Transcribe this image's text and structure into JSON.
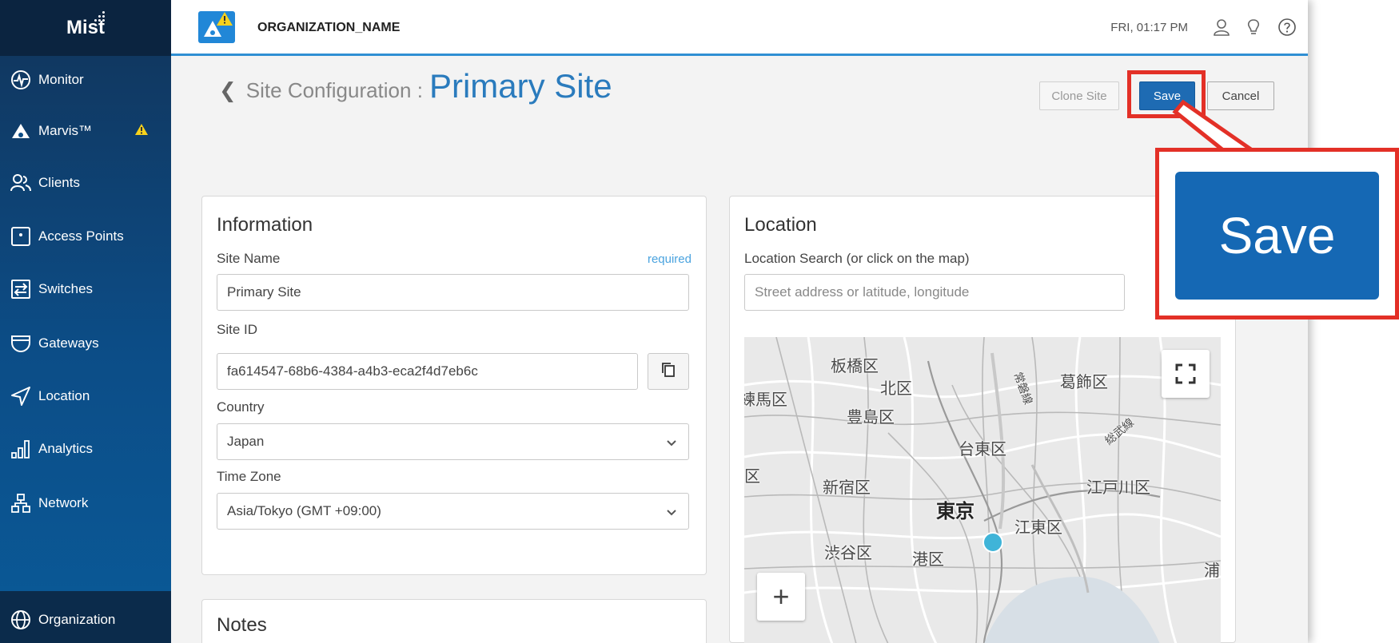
{
  "sidebar": {
    "logo": "Mist",
    "items": [
      {
        "label": "Monitor",
        "icon": "monitor-icon"
      },
      {
        "label": "Marvis™",
        "icon": "marvis-icon",
        "warning": true
      },
      {
        "label": "Clients",
        "icon": "clients-icon"
      },
      {
        "label": "Access Points",
        "icon": "access-point-icon"
      },
      {
        "label": "Switches",
        "icon": "switch-icon"
      },
      {
        "label": "Gateways",
        "icon": "gateway-icon"
      },
      {
        "label": "Location",
        "icon": "location-icon"
      },
      {
        "label": "Analytics",
        "icon": "analytics-icon"
      },
      {
        "label": "Network",
        "icon": "network-icon"
      },
      {
        "label": "Organization",
        "icon": "organization-icon",
        "active": true
      }
    ]
  },
  "header": {
    "org_name": "ORGANIZATION_NAME",
    "datetime": "FRI, 01:17 PM",
    "icons": [
      "user-icon",
      "lightbulb-icon",
      "help-icon"
    ]
  },
  "page": {
    "title_prefix": "Site Configuration :",
    "title_site": "Primary Site",
    "buttons": {
      "clone": "Clone Site",
      "save": "Save",
      "cancel": "Cancel"
    }
  },
  "information": {
    "heading": "Information",
    "site_name_label": "Site Name",
    "required_label": "required",
    "site_name_value": "Primary Site",
    "site_id_label": "Site ID",
    "site_id_value": "fa614547-68b6-4384-a4b3-eca2f4d7eb6c",
    "country_label": "Country",
    "country_value": "Japan",
    "timezone_label": "Time Zone",
    "timezone_value": "Asia/Tokyo (GMT +09:00)"
  },
  "notes": {
    "heading": "Notes"
  },
  "location": {
    "heading": "Location",
    "search_label": "Location Search (or click on the map)",
    "search_placeholder": "Street address or latitude, longitude",
    "map_labels": [
      "板橋区",
      "北区",
      "葛飾区",
      "練馬区",
      "豊島区",
      "台東区",
      "区",
      "新宿区",
      "江戸川区",
      "東京",
      "江東区",
      "渋谷区",
      "港区",
      "浦",
      "常磐線",
      "総武線"
    ],
    "zoom_in": "+"
  },
  "callout": {
    "label": "Save"
  },
  "colors": {
    "accent": "#1e6bb3",
    "highlight": "#e33027",
    "sidebar": "#0c4d87",
    "pin": "#3fb4d8"
  }
}
